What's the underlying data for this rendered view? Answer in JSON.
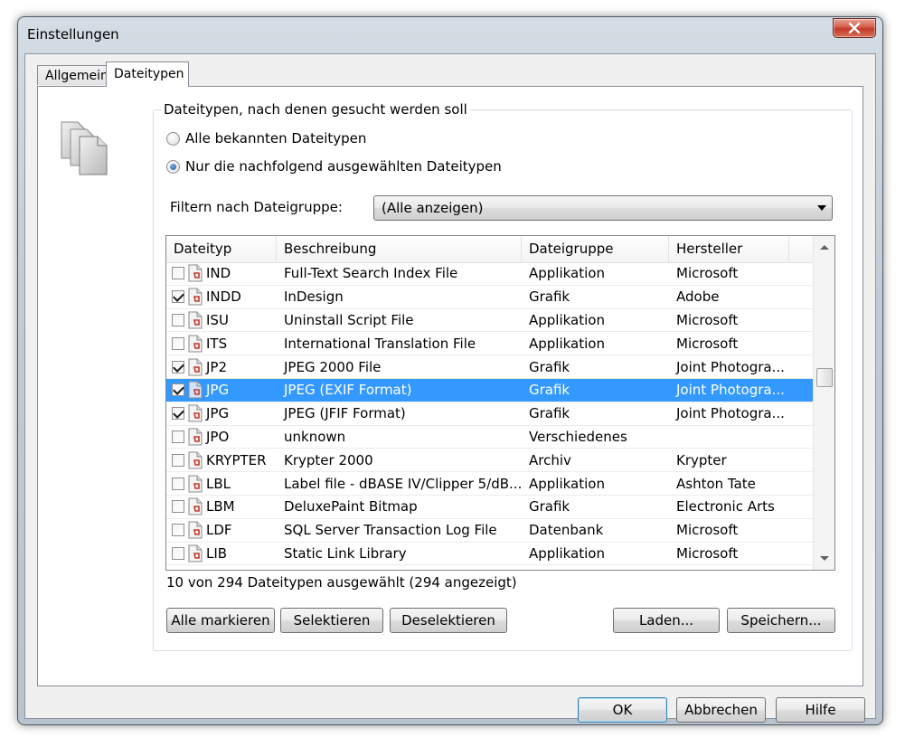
{
  "window": {
    "title": "Einstellungen"
  },
  "tabs": [
    {
      "label": "Allgemein"
    },
    {
      "label": "Dateitypen"
    }
  ],
  "group": {
    "title": "Dateitypen, nach denen gesucht werden soll",
    "radio_all": "Alle bekannten Dateitypen",
    "radio_selected": "Nur die nachfolgend ausgewählten Dateitypen",
    "selected_option": "radio_selected"
  },
  "filter": {
    "label": "Filtern nach Dateigruppe:",
    "value": "(Alle anzeigen)"
  },
  "list": {
    "columns": [
      "Dateityp",
      "Beschreibung",
      "Dateigruppe",
      "Hersteller"
    ],
    "rows": [
      {
        "type": "IND",
        "desc": "Full-Text Search Index File",
        "group": "Applikation",
        "vendor": "Microsoft",
        "checked": false,
        "selected": false
      },
      {
        "type": "INDD",
        "desc": "InDesign",
        "group": "Grafik",
        "vendor": "Adobe",
        "checked": true,
        "selected": false
      },
      {
        "type": "ISU",
        "desc": "Uninstall Script File",
        "group": "Applikation",
        "vendor": "Microsoft",
        "checked": false,
        "selected": false
      },
      {
        "type": "ITS",
        "desc": "International Translation File",
        "group": "Applikation",
        "vendor": "Microsoft",
        "checked": false,
        "selected": false
      },
      {
        "type": "JP2",
        "desc": "JPEG 2000 File",
        "group": "Grafik",
        "vendor": "Joint Photogra...",
        "checked": true,
        "selected": false
      },
      {
        "type": "JPG",
        "desc": "JPEG (EXIF Format)",
        "group": "Grafik",
        "vendor": "Joint Photogra...",
        "checked": true,
        "selected": true
      },
      {
        "type": "JPG",
        "desc": "JPEG (JFIF Format)",
        "group": "Grafik",
        "vendor": "Joint Photogra...",
        "checked": true,
        "selected": false
      },
      {
        "type": "JPO",
        "desc": "unknown",
        "group": "Verschiedenes",
        "vendor": "",
        "checked": false,
        "selected": false
      },
      {
        "type": "KRYPTER",
        "desc": "Krypter 2000",
        "group": "Archiv",
        "vendor": "Krypter",
        "checked": false,
        "selected": false
      },
      {
        "type": "LBL",
        "desc": "Label file - dBASE IV/Clipper 5/dB...",
        "group": "Applikation",
        "vendor": "Ashton Tate",
        "checked": false,
        "selected": false
      },
      {
        "type": "LBM",
        "desc": "DeluxePaint Bitmap",
        "group": "Grafik",
        "vendor": "Electronic Arts",
        "checked": false,
        "selected": false
      },
      {
        "type": "LDF",
        "desc": "SQL Server Transaction Log File",
        "group": "Datenbank",
        "vendor": "Microsoft",
        "checked": false,
        "selected": false
      },
      {
        "type": "LIB",
        "desc": "Static Link Library",
        "group": "Applikation",
        "vendor": "Microsoft",
        "checked": false,
        "selected": false
      }
    ]
  },
  "status": "10 von 294 Dateitypen ausgewählt (294 angezeigt)",
  "buttons": {
    "select_all": "Alle markieren",
    "select": "Selektieren",
    "deselect": "Deselektieren",
    "load": "Laden...",
    "save": "Speichern...",
    "ok": "OK",
    "cancel": "Abbrechen",
    "help": "Hilfe"
  },
  "colors": {
    "selection": "#3399ff",
    "close_button": "#c13a25",
    "file_icon_mark": "#c0392b"
  },
  "icons": {
    "header": "documents-icon",
    "file": "file-type-icon",
    "close": "close-icon"
  }
}
